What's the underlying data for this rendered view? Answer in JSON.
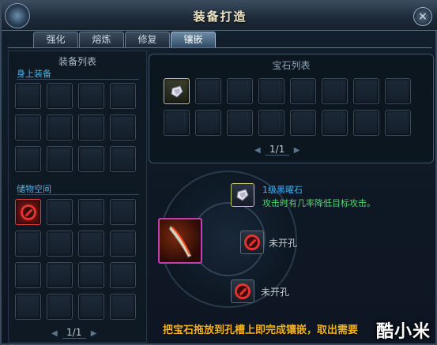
{
  "window": {
    "title": "装备打造"
  },
  "tabs": [
    {
      "label": "强化",
      "active": false
    },
    {
      "label": "熔炼",
      "active": false
    },
    {
      "label": "修复",
      "active": false
    },
    {
      "label": "镶嵌",
      "active": true
    }
  ],
  "left_panel": {
    "title": "装备列表",
    "equipped_label": "身上装备",
    "storage_label": "储物空间",
    "pager": "1/1",
    "storage_item_icon": "forbidden-equipment-icon"
  },
  "gem_list": {
    "title": "宝石列表",
    "pager": "1/1",
    "first_gem_icon": "gem-icon"
  },
  "inlay": {
    "gem_name": "1级黑曜石",
    "gem_desc": "攻击时有几率降低目标攻击。",
    "socket_1_label": "未开孔",
    "socket_2_label": "未开孔",
    "equipment_icon": "blade-icon"
  },
  "hint": "把宝石拖放到孔槽上即完成镶嵌，取出需要",
  "watermark": "酷小米",
  "colors": {
    "hint": "#f2b21c",
    "gem_name": "#36b7ff",
    "gem_desc": "#4fd36a",
    "active_tab": "#6b8aa5",
    "forbidden": "#e23232"
  }
}
